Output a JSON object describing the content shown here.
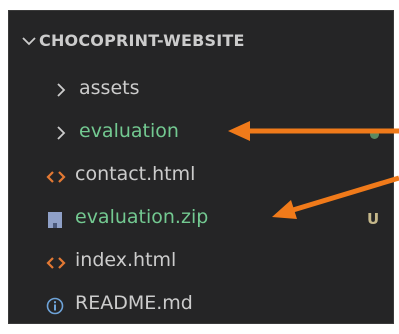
{
  "explorer": {
    "folder_title": "CHOCOPRINT-WEBSITE",
    "items": [
      {
        "label": "assets",
        "type": "folder",
        "status": "",
        "git": "none"
      },
      {
        "label": "evaluation",
        "type": "folder",
        "status": "",
        "git": "untracked-dot"
      },
      {
        "label": "contact.html",
        "type": "html-file",
        "status": "",
        "git": "none"
      },
      {
        "label": "evaluation.zip",
        "type": "zip-file",
        "status": "U",
        "git": "untracked"
      },
      {
        "label": "index.html",
        "type": "html-file",
        "status": "",
        "git": "none"
      },
      {
        "label": "README.md",
        "type": "info-file",
        "status": "",
        "git": "none"
      }
    ]
  },
  "colors": {
    "panel_bg": "#252526",
    "text": "#cccccc",
    "untracked_green": "#73c991",
    "status_letter": "#c5b88a",
    "html_icon": "#e37933",
    "zip_icon": "#8fa0c7",
    "info_icon": "#6ea3d8",
    "annotation_arrow": "#f07a1a"
  },
  "icons": {
    "collapse": "chevron-down-icon",
    "folder_closed": "chevron-right-icon",
    "html": "html-brackets-icon",
    "zip": "zip-file-icon",
    "info": "info-circle-icon"
  }
}
